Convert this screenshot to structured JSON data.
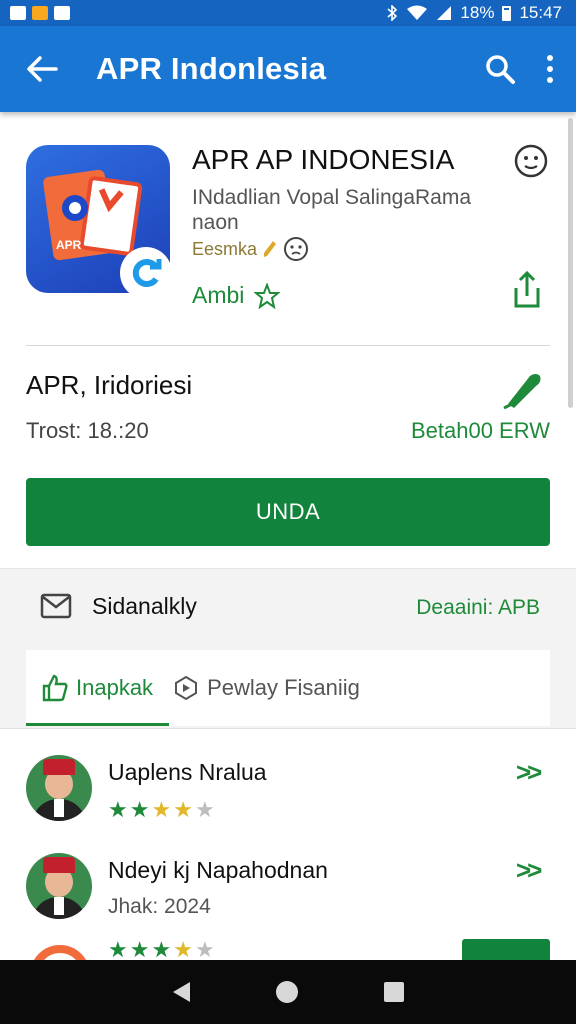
{
  "colors": {
    "status_bar": "#1565c0",
    "app_bar": "#1976d2",
    "primary_green": "#11833c",
    "accent_green": "#1e8a3a"
  },
  "status_bar": {
    "left_icons": [
      "notification-icon",
      "photo-icon",
      "gallery-icon"
    ],
    "right_icons": [
      "bluetooth-icon",
      "wifi-icon",
      "signal-icon",
      "battery-icon"
    ],
    "battery": "18%",
    "time": "15:47"
  },
  "app_bar": {
    "title": "APR Indonlesia",
    "back_icon": "arrow-left-icon",
    "search_icon": "search-icon",
    "more_icon": "more-vert-icon"
  },
  "app": {
    "icon_text": "APR",
    "name": "APR AP INDONESIA",
    "subtitle": "INdadlian Vopal SalingaRama naon",
    "rating_label": "Eesmka",
    "ambi_label": "Ambi"
  },
  "section": {
    "title": "APR, Iridoriesi",
    "trust": "Trost: 18.:20",
    "badge": "Betah00 ERW"
  },
  "install_button": "UNDA",
  "mail": {
    "label": "Sidanalkly",
    "link": "Deaaini: APB"
  },
  "tabs": [
    {
      "label": "Inapkak",
      "active": true
    },
    {
      "label": "Pewlay Fisaniig",
      "active": false
    }
  ],
  "reviews": [
    {
      "name": "Uaplens Nralua",
      "stars": 4,
      "subtitle": ""
    },
    {
      "name": "Ndeyi kj Napahodnan",
      "stars": 0,
      "subtitle": "Jhak: 2024"
    },
    {
      "name": "",
      "stars": 4,
      "subtitle": ""
    }
  ],
  "nav_bar": {
    "back": "nav-back-icon",
    "home": "nav-home-icon",
    "recent": "nav-recent-icon"
  }
}
